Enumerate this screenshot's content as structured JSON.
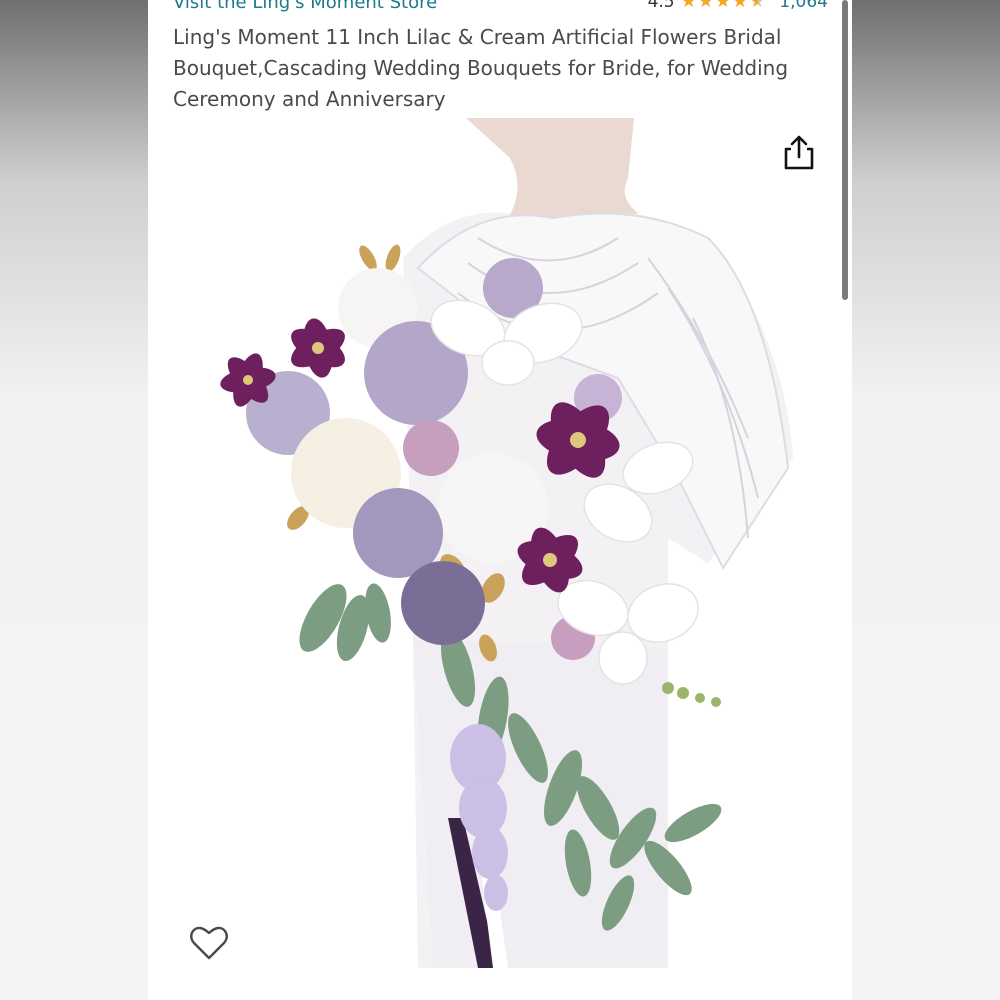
{
  "store": {
    "link_text": "Visit the Ling's Moment Store"
  },
  "rating": {
    "value": "4.5",
    "stars": 4.5,
    "review_count": "1,064"
  },
  "product": {
    "title": "Ling's Moment 11 Inch Lilac & Cream Artificial Flowers Bridal Bouquet,Cascading Wedding Bouquets for Bride, for Wedding Ceremony and Anniversary"
  },
  "icons": {
    "share": "share-icon",
    "favorite": "heart-icon",
    "star": "star-icon"
  },
  "colors": {
    "link": "#1c7a8c",
    "star": "#f5a623",
    "title": "#4a4a4a"
  }
}
